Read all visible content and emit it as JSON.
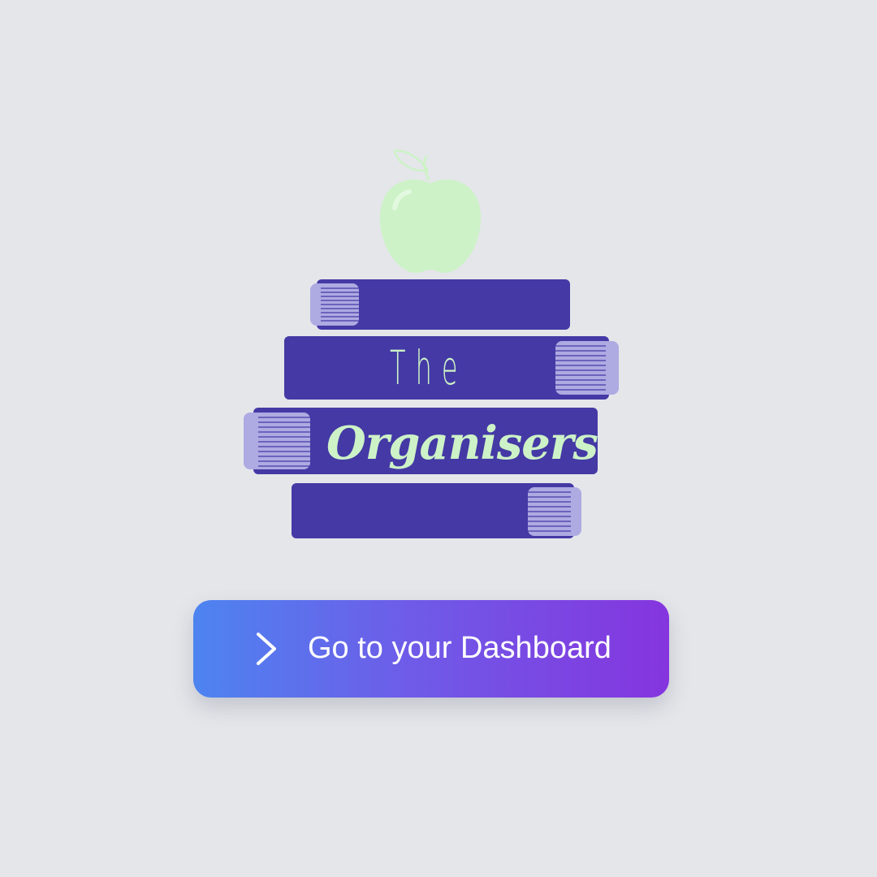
{
  "logo": {
    "line1": "The",
    "line2": "Organisers",
    "icons": [
      "apple-icon",
      "book-stack-icon"
    ]
  },
  "cta": {
    "label": "Go to your Dashboard",
    "icon": "chevron-right-icon"
  },
  "colors": {
    "background": "#e4e6ea",
    "book": "#4439a5",
    "book_pages": "#aeaae2",
    "apple": "#cdf2c7",
    "button_gradient_start": "#4d84f0",
    "button_gradient_end": "#8535de",
    "button_text": "#ffffff"
  }
}
